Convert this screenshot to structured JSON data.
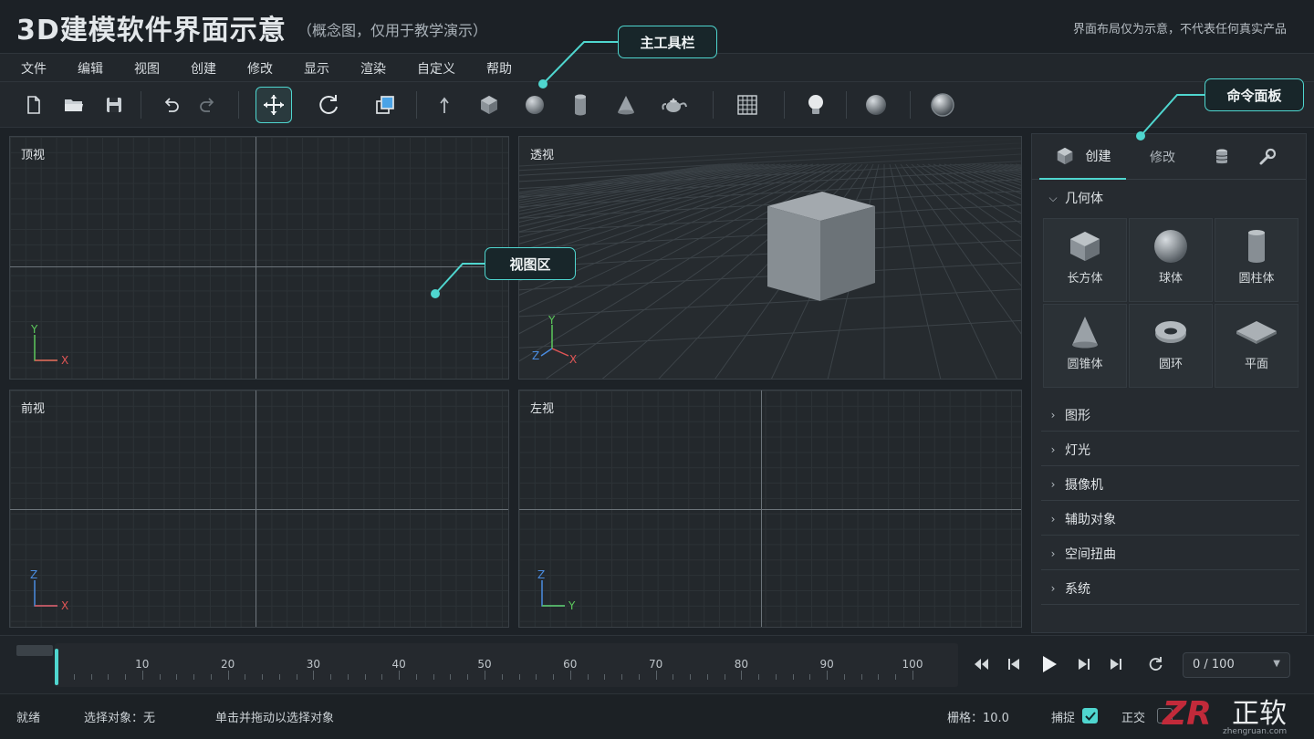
{
  "header": {
    "title": "3D建模软件界面示意",
    "subtitle": "（概念图，仅用于教学演示）",
    "disclaimer": "界面布局仅为示意，不代表任何真实产品"
  },
  "menu": [
    "文件",
    "编辑",
    "视图",
    "创建",
    "修改",
    "显示",
    "渲染",
    "自定义",
    "帮助"
  ],
  "toolbar": {
    "tools": [
      "new-file-icon",
      "open-folder-icon",
      "save-icon",
      "undo-icon",
      "redo-icon",
      "move-icon",
      "rotate-icon",
      "scale-icon",
      "select-arrow-icon",
      "box-icon",
      "sphere-icon",
      "cylinder-icon",
      "cone-icon",
      "teapot-icon",
      "grid-icon",
      "light-bulb-icon",
      "material-sphere-icon",
      "render-sphere-icon"
    ],
    "active_tool": "move-icon"
  },
  "callouts": {
    "main_toolbar": "主工具栏",
    "command_panel": "命令面板",
    "viewport_area": "视图区"
  },
  "viewports": [
    {
      "label": "顶视",
      "axis_up": "Y",
      "axis_right": "X"
    },
    {
      "label": "透视",
      "axis_up": "Y",
      "axis_right": "X",
      "axis_third": "Z"
    },
    {
      "label": "前视",
      "axis_up": "Z",
      "axis_right": "X"
    },
    {
      "label": "左视",
      "axis_up": "Z",
      "axis_right": "Y"
    }
  ],
  "command_panel": {
    "tabs": {
      "create": "创建",
      "modify": "修改"
    },
    "tab_icons": [
      "cube-icon",
      "database-icon",
      "wrench-icon"
    ],
    "expanded_section": "几何体",
    "geometry_items": [
      "长方体",
      "球体",
      "圆柱体",
      "圆锥体",
      "圆环",
      "平面"
    ],
    "sections": [
      "图形",
      "灯光",
      "摄像机",
      "辅助对象",
      "空间扭曲",
      "系统"
    ]
  },
  "timeline": {
    "ticks": [
      "10",
      "20",
      "30",
      "40",
      "50",
      "60",
      "70",
      "80",
      "90",
      "100"
    ],
    "frame_display": "0 / 100",
    "current_frame": 0,
    "total_frames": 100
  },
  "status": {
    "ready": "就绪",
    "selected": "选择对象：无",
    "hint": "单击并拖动以选择对象",
    "grid": "栅格：10.0",
    "snap": "捕捉",
    "snap_checked": true,
    "ortho": "正交",
    "ortho_checked": false
  },
  "watermark": {
    "text": "正软",
    "site": "zhengruan.com"
  },
  "colors": {
    "accent": "#4fd6cf",
    "axis_x": "#e05555",
    "axis_y": "#5cc85c",
    "axis_z": "#4a8ce0"
  }
}
